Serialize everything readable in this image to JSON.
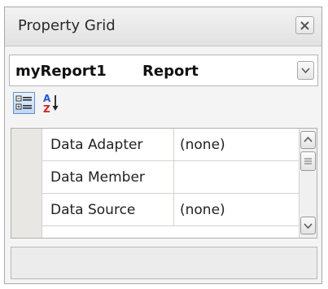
{
  "window": {
    "title": "Property Grid"
  },
  "selector": {
    "object_name": "myReport1",
    "object_type": "Report"
  },
  "toolbar": {
    "categorized_label": "Categorized",
    "alphabetical_label": "Alphabetical",
    "az_top": "A",
    "az_bottom": "Z"
  },
  "properties": [
    {
      "name": "Data Adapter",
      "value": "(none)"
    },
    {
      "name": "Data Member",
      "value": ""
    },
    {
      "name": "Data Source",
      "value": "(none)"
    }
  ],
  "colors": {
    "accent_blue": "#1f5bd6",
    "accent_red": "#d32020",
    "border": "#a8a8a8"
  },
  "icons": {
    "close": "close-icon",
    "dropdown": "chevron-down-icon",
    "categorized": "categorized-icon",
    "alphabetical": "sort-az-icon",
    "scroll_up": "chevron-up-icon",
    "scroll_down": "chevron-down-icon",
    "thumb": "scroll-thumb-grip-icon"
  }
}
